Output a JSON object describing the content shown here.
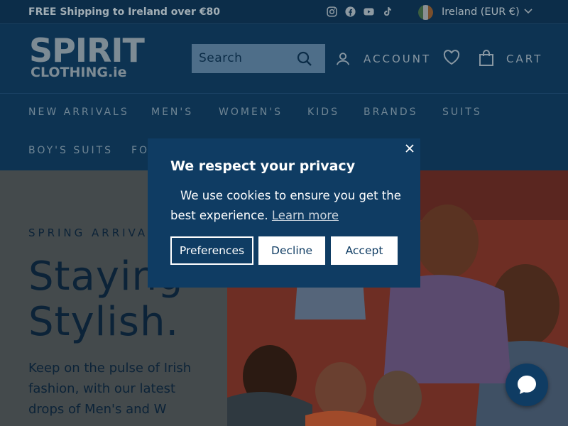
{
  "announcement": {
    "shipping_text": "FREE Shipping to Ireland over €80",
    "socials": [
      "instagram-icon",
      "facebook-icon",
      "youtube-icon",
      "tiktok-icon"
    ],
    "region": "Ireland (EUR €)"
  },
  "header": {
    "logo_line1": "SPIRIT",
    "logo_line2": "CLOTHING.ie",
    "search_placeholder": "Search",
    "account_label": "ACCOUNT",
    "cart_label": "CART"
  },
  "nav": {
    "items": [
      "NEW ARRIVALS",
      "MEN'S",
      "WOMEN'S",
      "KIDS",
      "BRANDS",
      "SUITS",
      "BOY'S SUITS",
      "FO"
    ]
  },
  "hero": {
    "kicker": "SPRING ARRIVA",
    "headline_line1": "Staying",
    "headline_line2": "Stylish.",
    "body": "Keep on the pulse of Irish fashion, with our latest drops of Men's and W"
  },
  "cookie_modal": {
    "title": "We respect your privacy",
    "body": "We use cookies to ensure you get the best experience.",
    "learn_more": "Learn more",
    "preferences_label": "Preferences",
    "decline_label": "Decline",
    "accept_label": "Accept"
  },
  "colors": {
    "header_bg": "#0d3352",
    "modal_bg": "#0f3c63",
    "button_bg": "#ffffff"
  }
}
